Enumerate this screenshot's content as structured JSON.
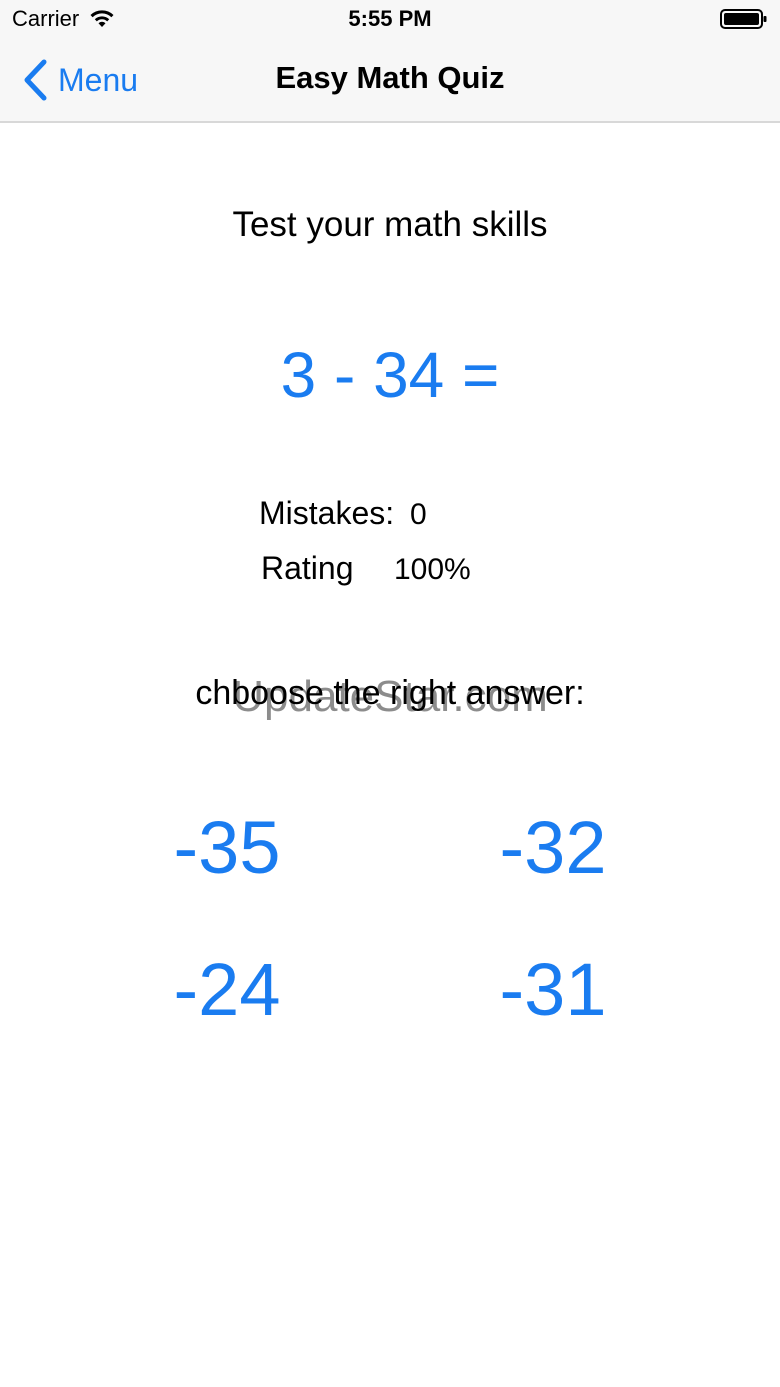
{
  "status_bar": {
    "carrier": "Carrier",
    "time": "5:55 PM"
  },
  "nav": {
    "back_label": "Menu",
    "title": "Easy Math Quiz"
  },
  "main": {
    "subtitle": "Test your math skills",
    "question": "3 - 34 =",
    "mistakes_label": "Mistakes:",
    "mistakes_value": "0",
    "rating_label": "Rating",
    "rating_value": "100%",
    "instruction": "chboose the right answer:",
    "watermark": "UpdateStar.com",
    "answers": [
      "-35",
      "-32",
      "-24",
      "-31"
    ]
  },
  "colors": {
    "accent": "#1a7cf0",
    "nav_background": "#f7f7f7"
  },
  "icons": [
    "wifi-icon",
    "battery-icon",
    "chevron-left-icon"
  ]
}
